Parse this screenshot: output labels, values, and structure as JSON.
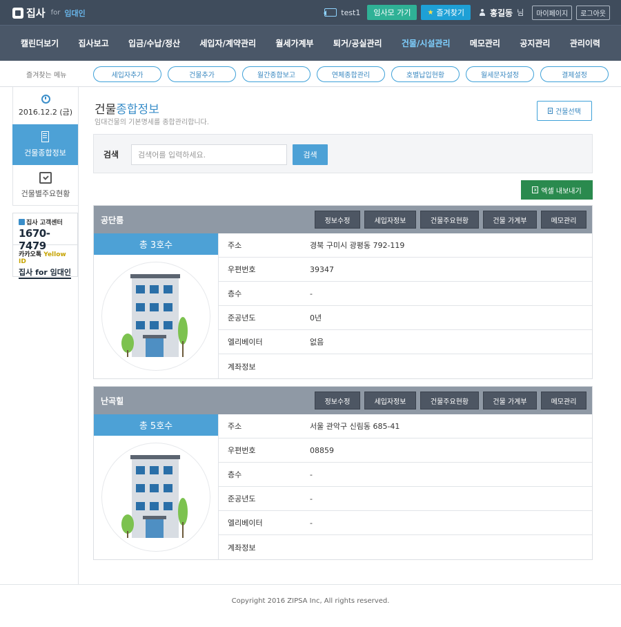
{
  "header": {
    "logo_text": "집사",
    "logo_for": "for",
    "logo_sub": "임대인",
    "user_id": "test1",
    "go_button": "임사모 가기",
    "favorite_button": "즐겨찾기",
    "user_name": "홍길동",
    "user_suffix": "님",
    "mypage_button": "마이페이지",
    "logout_button": "로그아웃"
  },
  "nav": {
    "items": [
      {
        "label": "캘린더보기"
      },
      {
        "label": "집사보고"
      },
      {
        "label": "입금/수납/정산"
      },
      {
        "label": "세입자/계약관리"
      },
      {
        "label": "월세가계부"
      },
      {
        "label": "퇴거/공실관리"
      },
      {
        "label": "건물/시설관리"
      },
      {
        "label": "메모관리"
      },
      {
        "label": "공지관리"
      },
      {
        "label": "관리이력"
      }
    ],
    "active_index": 6
  },
  "favorites": {
    "label": "즐겨찾는 메뉴",
    "items": [
      {
        "label": "세입자추가"
      },
      {
        "label": "건물추가"
      },
      {
        "label": "월간종합보고"
      },
      {
        "label": "연체종합관리"
      },
      {
        "label": "호별납입현황"
      },
      {
        "label": "월세문자설정"
      },
      {
        "label": "결제설정"
      }
    ]
  },
  "sidebar": {
    "date": "2016.12.2 (금)",
    "active_menu": "건물종합정보",
    "menu2": "건물별주요현황",
    "contact_title": "집사 고객센터",
    "contact_phone": "1670-7479",
    "kakao_prefix": "카카오톡",
    "kakao_yellow": "Yellow ID",
    "kakao_name": "집사 for 임대인"
  },
  "page": {
    "title_plain": "건물",
    "title_accent": "종합정보",
    "subtitle": "임대건물의 기본명세를 종합관리합니다.",
    "select_button": "건물선택"
  },
  "search": {
    "label": "검색",
    "placeholder": "검색어를 입력하세요.",
    "button": "검색"
  },
  "excel_button": "엑셀 내보내기",
  "card_actions": [
    "정보수정",
    "세입자정보",
    "건물주요현황",
    "건물 가계부",
    "메모관리"
  ],
  "info_labels": [
    "주소",
    "우편번호",
    "층수",
    "준공년도",
    "엘리베이터",
    "계좌정보"
  ],
  "buildings": [
    {
      "name": "공단룸",
      "units": "총 3호수",
      "info": [
        "경북 구미시 광평동 792-119",
        "39347",
        "-",
        "0년",
        "없음",
        ""
      ]
    },
    {
      "name": "난곡힐",
      "units": "총 5호수",
      "info": [
        "서울 관악구 신림동 685-41",
        "08859",
        "-",
        "-",
        "-",
        ""
      ]
    }
  ],
  "footer": {
    "copyright": "Copyright 2016 ZIPSA Inc, All rights reserved."
  },
  "colors": {
    "topbar": "#3f4c5c",
    "nav": "#4a5768",
    "accent_blue": "#4da1d6",
    "excel_green": "#2a8a4e"
  }
}
